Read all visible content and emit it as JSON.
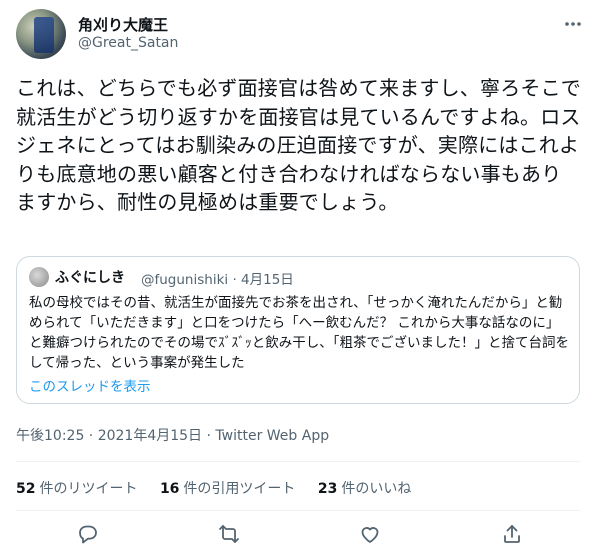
{
  "author": {
    "name": "角刈り大魔王",
    "handle": "@Great_Satan"
  },
  "tweet": {
    "text": "これは、どちらでも必ず面接官は咎めて来ますし、寧ろそこで就活生がどう切り返すかを面接官は見ているんですよね。ロスジェネにとってはお馴染みの圧迫面接ですが、実際にはこれよりも底意地の悪い顧客と付き合わなければならない事もありますから、耐性の見極めは重要でしょう。",
    "timestamp": "午後10:25 · 2021年4月15日 · Twitter Web App"
  },
  "quoted": {
    "name": "ふぐにしき",
    "handle_date": "@fugunishiki · 4月15日",
    "text": "私の母校ではその昔、就活生が面接先でお茶を出され、「せっかく淹れたんだから」と勧められて「いただきます」と口をつけたら「へー飲むんだ？ これから大事な話なのに」と難癖つけられたのでその場でｽﾞｽﾞｯと飲み干し、「粗茶でございました！」と捨て台詞をして帰った、という事案が発生した",
    "thread_link": "このスレッドを表示"
  },
  "stats": {
    "retweets_count": "52",
    "retweets_label": "件のリツイート",
    "quotes_count": "16",
    "quotes_label": "件の引用ツイート",
    "likes_count": "23",
    "likes_label": "件のいいね"
  },
  "icons": [
    "more-icon",
    "reply-icon",
    "retweet-icon",
    "like-icon",
    "share-icon"
  ],
  "colors": {
    "link": "#1d9bf0",
    "secondary_text": "#536471",
    "border": "#cfd9de"
  }
}
